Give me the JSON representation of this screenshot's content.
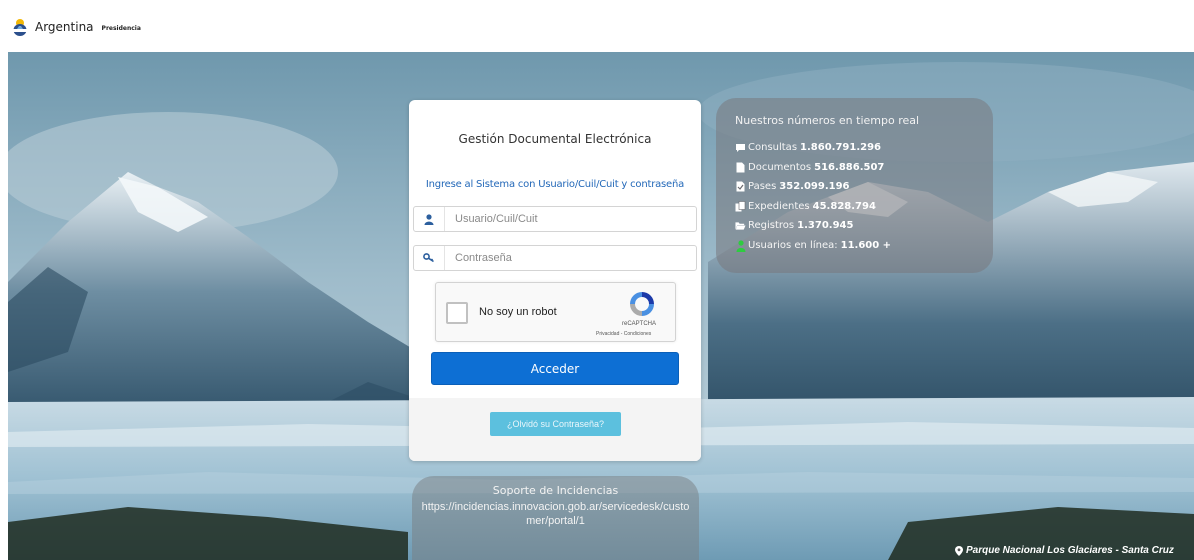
{
  "header": {
    "logo_name": "Argentina",
    "logo_sub": "Presidencia"
  },
  "login": {
    "title": "Gestión Documental Electrónica",
    "subtitle": "Ingrese al Sistema con Usuario/Cuil/Cuit y contraseña",
    "username_placeholder": "Usuario/Cuil/Cuit",
    "username_value": "",
    "password_placeholder": "Contraseña",
    "password_value": "",
    "captcha_label": "No soy un robot",
    "captcha_brand": "reCAPTCHA",
    "captcha_links": "Privacidad - Condiciones",
    "submit_label": "Acceder",
    "forgot_label": "¿Olvidó su Contraseña?"
  },
  "stats": {
    "title": "Nuestros números en tiempo real",
    "items": [
      {
        "icon": "comment-icon",
        "label": "Consultas",
        "value": "1.860.791.296"
      },
      {
        "icon": "file-icon",
        "label": "Documentos",
        "value": "516.886.507"
      },
      {
        "icon": "file-pass-icon",
        "label": "Pases",
        "value": "352.099.196"
      },
      {
        "icon": "files-icon",
        "label": "Expedientes",
        "value": "45.828.794"
      },
      {
        "icon": "folder-open-icon",
        "label": "Registros",
        "value": "1.370.945"
      },
      {
        "icon": "user-icon",
        "label": "Usuarios en línea:",
        "value": "11.600 +"
      }
    ]
  },
  "support": {
    "title": "Soporte de Incidencias",
    "url": "https://incidencias.innovacion.gob.ar/servicedesk/customer/portal/1"
  },
  "location": {
    "text": "Parque Nacional Los Glaciares - Santa Cruz"
  },
  "colors": {
    "primary": "#0d6fd4",
    "link": "#2368b8",
    "info": "#5cc0de"
  }
}
